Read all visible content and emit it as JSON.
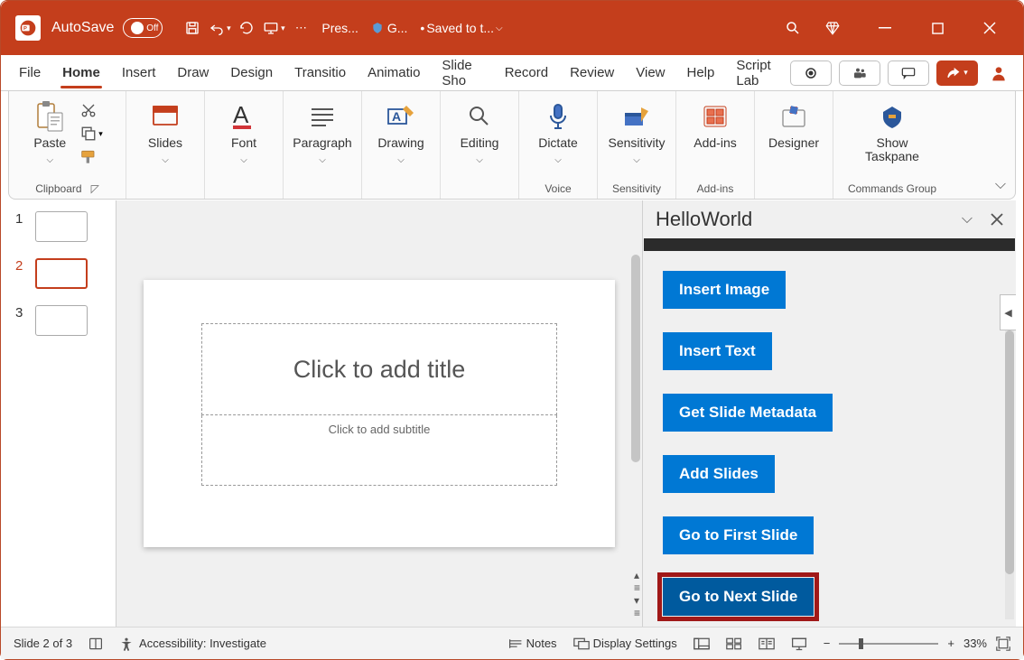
{
  "titlebar": {
    "autosave_label": "AutoSave",
    "autosave_state": "Off",
    "file_short": "Pres...",
    "shield_text": "G...",
    "saved_text": "Saved to t..."
  },
  "tabs": {
    "file": "File",
    "home": "Home",
    "insert": "Insert",
    "draw": "Draw",
    "design": "Design",
    "transitions": "Transitio",
    "animations": "Animatio",
    "slideshow": "Slide Sho",
    "record": "Record",
    "review": "Review",
    "view": "View",
    "help": "Help",
    "scriptlab": "Script Lab"
  },
  "ribbon": {
    "clipboard": {
      "paste": "Paste",
      "label": "Clipboard"
    },
    "slides": {
      "btn": "Slides"
    },
    "font": {
      "btn": "Font"
    },
    "paragraph": {
      "btn": "Paragraph"
    },
    "drawing": {
      "btn": "Drawing"
    },
    "editing": {
      "btn": "Editing"
    },
    "dictate": {
      "btn": "Dictate",
      "label": "Voice"
    },
    "sensitivity": {
      "btn": "Sensitivity",
      "label": "Sensitivity"
    },
    "addins": {
      "btn": "Add-ins",
      "label": "Add-ins"
    },
    "designer": {
      "btn": "Designer"
    },
    "taskpane": {
      "btn": "Show\nTaskpane",
      "label": "Commands Group"
    }
  },
  "thumbs": [
    "1",
    "2",
    "3"
  ],
  "slide": {
    "title_ph": "Click to add title",
    "sub_ph": "Click to add subtitle"
  },
  "taskpane": {
    "title": "HelloWorld",
    "buttons": {
      "insert_image": "Insert Image",
      "insert_text": "Insert Text",
      "metadata": "Get Slide Metadata",
      "add_slides": "Add Slides",
      "first": "Go to First Slide",
      "next": "Go to Next Slide"
    }
  },
  "status": {
    "slide": "Slide 2 of 3",
    "accessibility": "Accessibility: Investigate",
    "notes": "Notes",
    "display": "Display Settings",
    "zoom": "33%"
  }
}
